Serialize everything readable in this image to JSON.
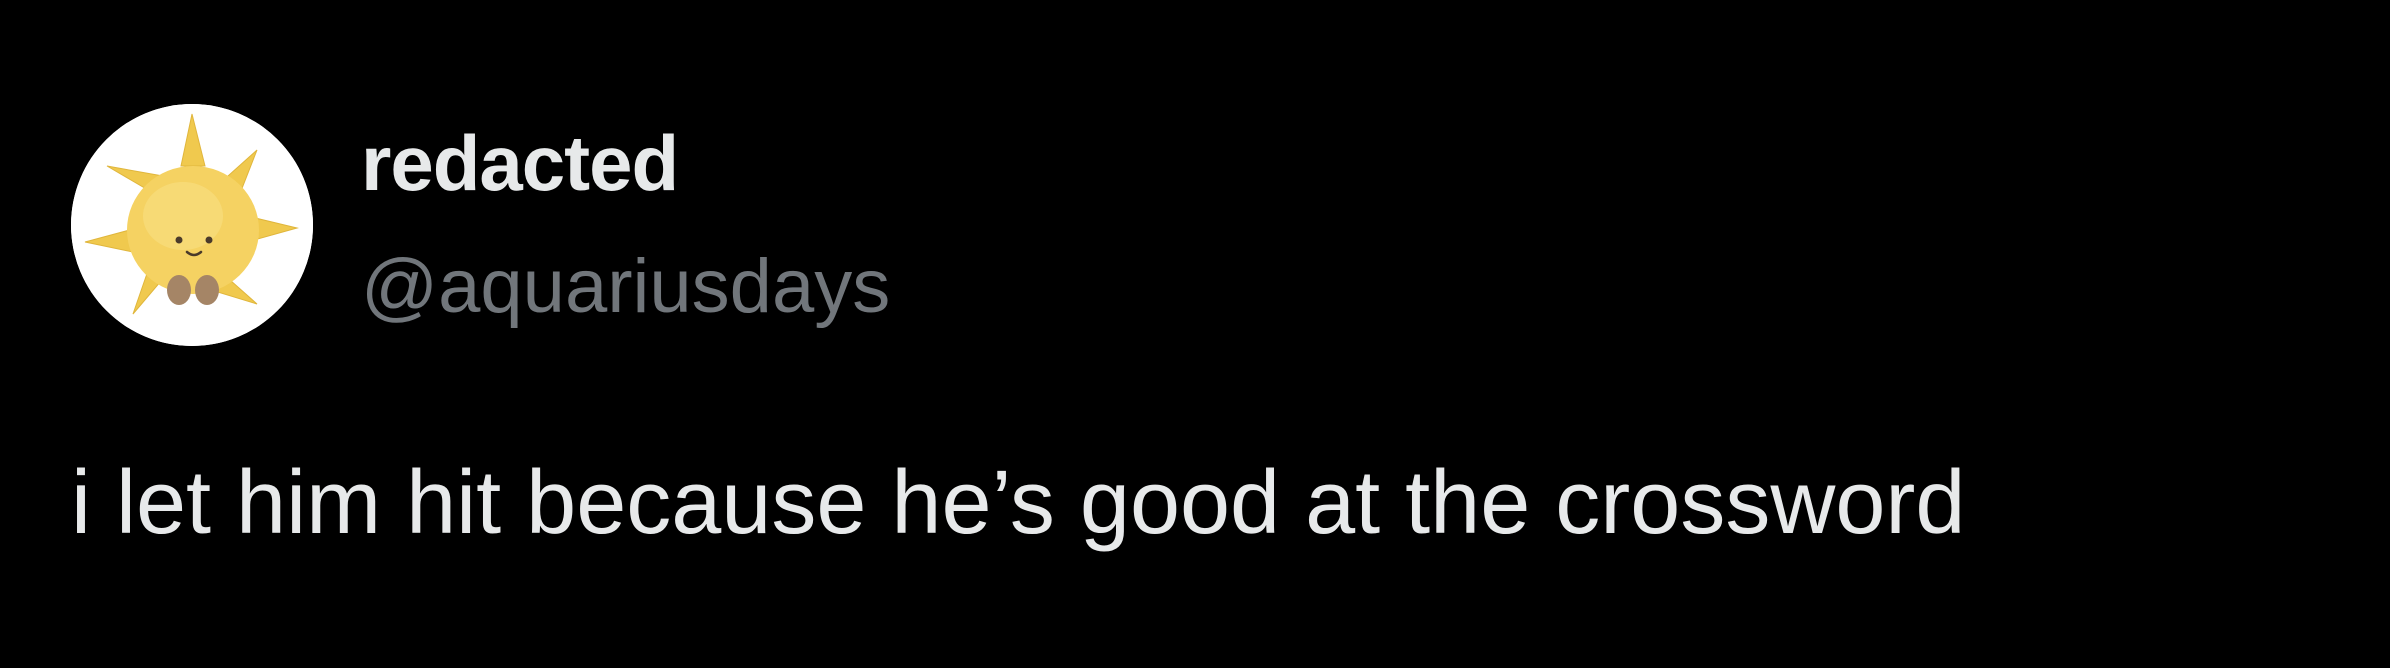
{
  "tweet": {
    "author": {
      "display_name": "redacted",
      "handle": "@aquariusdays",
      "avatar_icon": "yellow-sun-plush-icon"
    },
    "text": "i let him hit because he’s good at the crossword"
  },
  "colors": {
    "background": "#000000",
    "primary_text": "#e7e9ea",
    "secondary_text": "#71767b",
    "avatar_sun": "#f2cf5b"
  }
}
